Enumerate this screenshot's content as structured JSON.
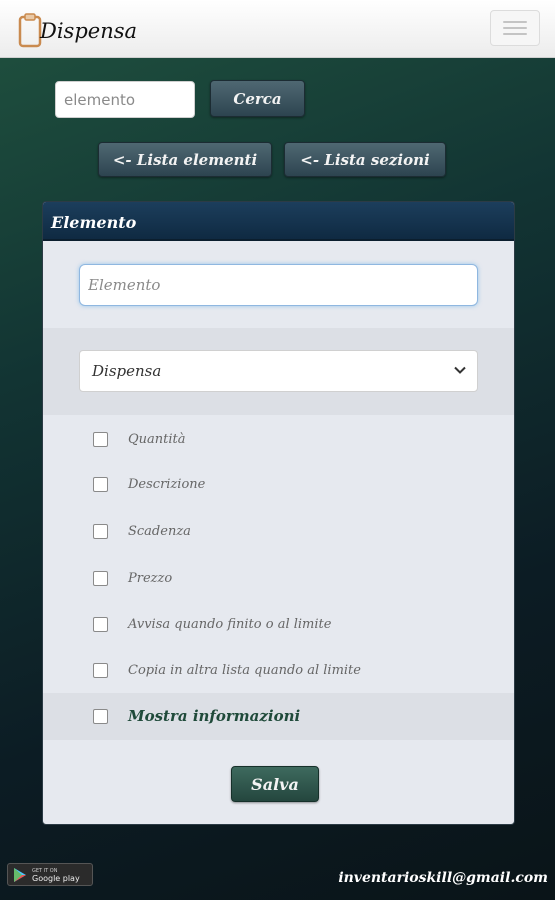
{
  "header": {
    "brand": "Dispensa",
    "icons": {
      "brand": "clipboard-icon",
      "menu": "hamburger-icon"
    }
  },
  "search": {
    "placeholder": "elemento",
    "button_label": "Cerca"
  },
  "nav": {
    "items_button": "<- Lista elementi",
    "sections_button": "<- Lista sezioni"
  },
  "panel": {
    "title": "Elemento",
    "name_placeholder": "Elemento",
    "section_select": {
      "selected": "Dispensa",
      "icon": "chevron-down-icon"
    },
    "options": [
      {
        "label": "Quantità",
        "checked": false
      },
      {
        "label": "Descrizione",
        "checked": false
      },
      {
        "label": "Scadenza",
        "checked": false
      },
      {
        "label": "Prezzo",
        "checked": false
      },
      {
        "label": "Avvisa quando finito o al limite",
        "checked": false
      },
      {
        "label": "Copia in altra lista quando al limite",
        "checked": false
      }
    ],
    "show_info": {
      "label": "Mostra informazioni",
      "checked": false
    },
    "save_label": "Salva"
  },
  "footer": {
    "store_badge": {
      "small": "GET IT ON",
      "big": "Google play",
      "icon": "google-play-icon"
    },
    "email": "inventarioskill@gmail.com"
  },
  "colors": {
    "accent": "#1c3e5c",
    "button": "#3b5561",
    "save_button": "#33584f",
    "info_label": "#1f4a3a"
  }
}
